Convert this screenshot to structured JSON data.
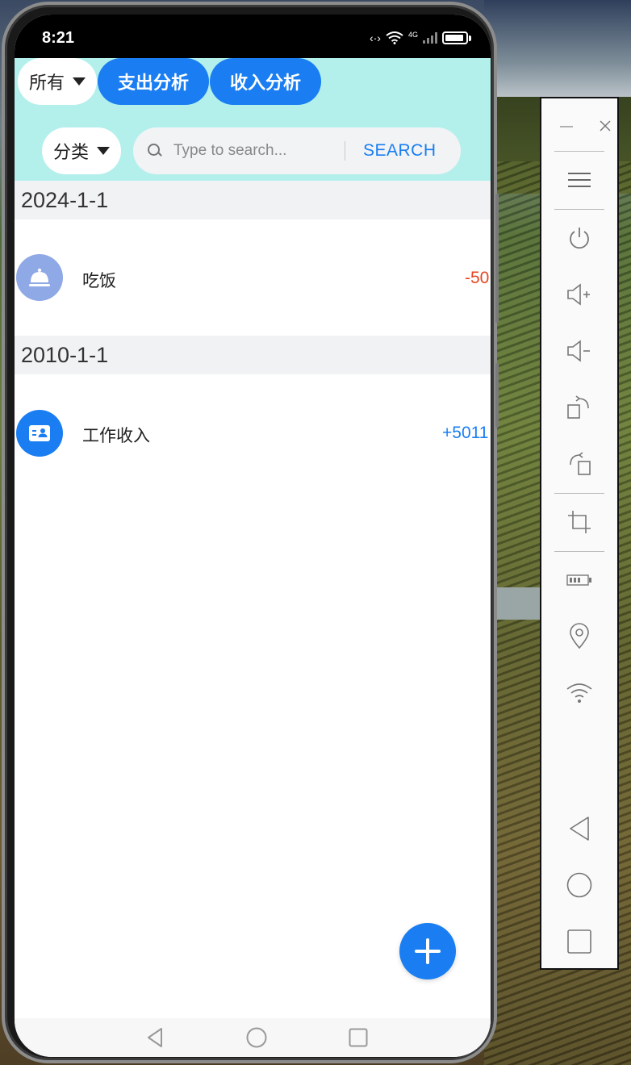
{
  "status_bar": {
    "time": "8:21",
    "network": "4G"
  },
  "header": {
    "filter_all": "所有",
    "expense_analysis": "支出分析",
    "income_analysis": "收入分析",
    "category": "分类",
    "search_placeholder": "Type to search...",
    "search_button": "SEARCH"
  },
  "groups": [
    {
      "date": "2024-1-1",
      "entries": [
        {
          "label": "吃饭",
          "amount": "-50",
          "icon": "cloche-icon",
          "icon_color": "#8fa9e6",
          "amount_color": "#e8461f"
        }
      ]
    },
    {
      "date": "2010-1-1",
      "entries": [
        {
          "label": "工作收入",
          "amount": "+5011",
          "icon": "id-card-icon",
          "icon_color": "#1a7ef2",
          "amount_color": "#1a7ef2"
        }
      ]
    }
  ],
  "fab": {
    "icon": "plus-icon"
  },
  "colors": {
    "accent": "#1a7ef2",
    "header_bg": "#b3f0ec",
    "expense": "#e8461f",
    "income": "#1a7ef2"
  },
  "emulator_toolbar": {
    "items": [
      "minimize-icon",
      "close-icon",
      "menu-icon",
      "power-icon",
      "volume-up-icon",
      "volume-down-icon",
      "rotate-right-icon",
      "rotate-left-icon",
      "crop-icon",
      "battery-icon",
      "location-icon",
      "wifi-icon",
      "back-icon",
      "home-icon",
      "recents-icon"
    ]
  }
}
